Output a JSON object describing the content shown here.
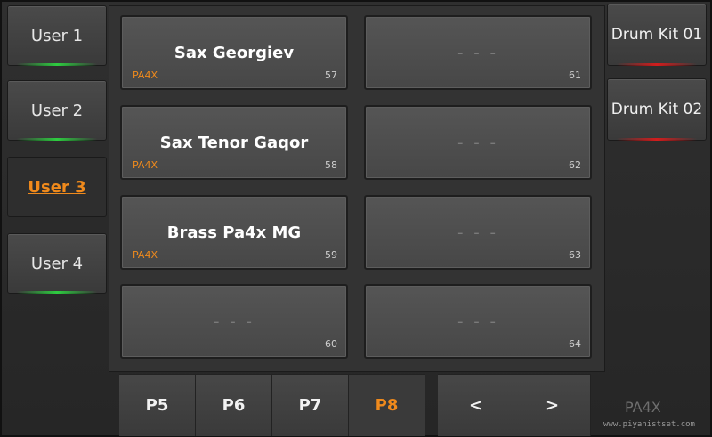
{
  "left_tabs": [
    {
      "label": "User 1"
    },
    {
      "label": "User 2"
    },
    {
      "label": "User 3"
    },
    {
      "label": "User 4"
    }
  ],
  "right_tabs": [
    {
      "label": "Drum Kit 01"
    },
    {
      "label": "Drum Kit 02"
    }
  ],
  "slots": [
    {
      "name": "Sax Georgiev",
      "origin": "PA4X",
      "num": "57"
    },
    {
      "name": "- - -",
      "origin": "",
      "num": "61"
    },
    {
      "name": "Sax Tenor Gaqor",
      "origin": "PA4X",
      "num": "58"
    },
    {
      "name": "- - -",
      "origin": "",
      "num": "62"
    },
    {
      "name": "Brass Pa4x MG",
      "origin": "PA4X",
      "num": "59"
    },
    {
      "name": "- - -",
      "origin": "",
      "num": "63"
    },
    {
      "name": "- - -",
      "origin": "",
      "num": "60"
    },
    {
      "name": "- - -",
      "origin": "",
      "num": "64"
    }
  ],
  "pages": [
    {
      "label": "P5"
    },
    {
      "label": "P6"
    },
    {
      "label": "P7"
    },
    {
      "label": "P8"
    }
  ],
  "nav": {
    "prev": "<",
    "next": ">"
  },
  "brand": "PA4X",
  "watermark": "www.piyanistset.com",
  "colors": {
    "accent": "#f08a1c",
    "led_green": "#2ecc40",
    "led_red": "#d21d1d"
  }
}
